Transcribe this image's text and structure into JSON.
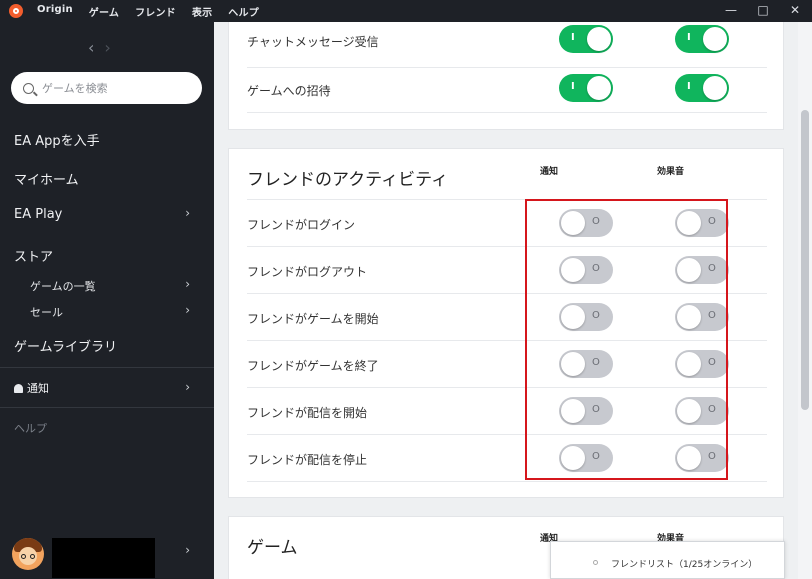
{
  "titlebar": {
    "app_name": "Origin",
    "menu": [
      "ゲーム",
      "フレンド",
      "表示",
      "ヘルプ"
    ],
    "minimize": "—",
    "maximize": "□",
    "close": "✕"
  },
  "sidebar": {
    "back_arrow": "‹",
    "forward_arrow": "›",
    "search_placeholder": "ゲームを検索",
    "items": {
      "ea_app": "EA Appを入手",
      "my_home": "マイホーム",
      "ea_play": "EA Play",
      "store": "ストア",
      "store_browse": "ゲームの一覧",
      "store_sale": "セール",
      "library": "ゲームライブラリ",
      "notifications": "通知",
      "help": "ヘルプ"
    },
    "chevron": "›"
  },
  "top_section": {
    "rows": [
      {
        "label": "チャットメッセージ受信",
        "notify": "on",
        "sound": "on"
      },
      {
        "label": "ゲームへの招待",
        "notify": "on",
        "sound": "on"
      }
    ]
  },
  "friend_activity": {
    "title": "フレンドのアクティビティ",
    "col_notify": "通知",
    "col_sound": "効果音",
    "rows": [
      {
        "label": "フレンドがログイン",
        "notify": "off",
        "sound": "off"
      },
      {
        "label": "フレンドがログアウト",
        "notify": "off",
        "sound": "off"
      },
      {
        "label": "フレンドがゲームを開始",
        "notify": "off",
        "sound": "off"
      },
      {
        "label": "フレンドがゲームを終了",
        "notify": "off",
        "sound": "off"
      },
      {
        "label": "フレンドが配信を開始",
        "notify": "off",
        "sound": "off"
      },
      {
        "label": "フレンドが配信を停止",
        "notify": "off",
        "sound": "off"
      }
    ]
  },
  "game_section": {
    "title": "ゲーム",
    "col_notify": "通知",
    "col_sound": "効果音"
  },
  "toggle_marks": {
    "on": "I",
    "off": "O"
  },
  "friends_popup": {
    "text": "フレンドリスト（1/25オンライン）"
  },
  "colors": {
    "toggle_on": "#10b55d",
    "toggle_off": "#c7c9cf",
    "highlight_box": "#d5161c",
    "sidebar_bg": "#1e2127"
  }
}
